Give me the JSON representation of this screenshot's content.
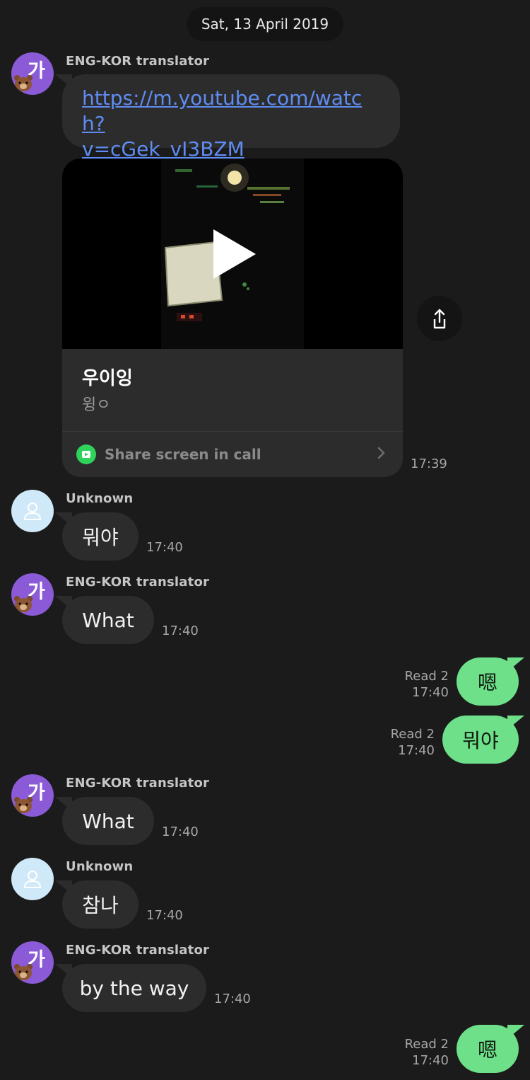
{
  "date_divider": "Sat, 13 April 2019",
  "colors": {
    "background": "#1b1b1b",
    "incoming_bubble": "#2c2c2c",
    "outgoing_bubble": "#6ee08a",
    "link": "#5f8cf2",
    "bot_avatar": "#8b5ad6",
    "user_avatar": "#cfe9f8",
    "share_icon": "#2fd35b"
  },
  "messages": [
    {
      "sender": "ENG-KOR translator",
      "avatar_icon": "ga-bear-icon",
      "link": "https://m.youtube.com/watch?v=cGek_vI3BZM",
      "link_line1": "https://m.youtube.com/watch?",
      "link_line2": "v=cGek_vI3BZM",
      "preview": {
        "title": "우이잉",
        "subtitle": "윙ㅇ",
        "share_label": "Share screen in call"
      },
      "time": "17:39"
    },
    {
      "sender": "Unknown",
      "avatar_icon": "person-icon",
      "text": "뭐야",
      "time": "17:40"
    },
    {
      "sender": "ENG-KOR translator",
      "avatar_icon": "ga-bear-icon",
      "text": "What",
      "time": "17:40"
    },
    {
      "outgoing": true,
      "read": "Read 2",
      "time": "17:40",
      "text": "嗯"
    },
    {
      "outgoing": true,
      "read": "Read 2",
      "time": "17:40",
      "text": "뭐야"
    },
    {
      "sender": "ENG-KOR translator",
      "avatar_icon": "ga-bear-icon",
      "text": "What",
      "time": "17:40"
    },
    {
      "sender": "Unknown",
      "avatar_icon": "person-icon",
      "text": "참나",
      "time": "17:40"
    },
    {
      "sender": "ENG-KOR translator",
      "avatar_icon": "ga-bear-icon",
      "text": "by the way",
      "time": "17:40"
    },
    {
      "outgoing": true,
      "read": "Read 2",
      "time": "17:40",
      "text": "嗯"
    }
  ]
}
